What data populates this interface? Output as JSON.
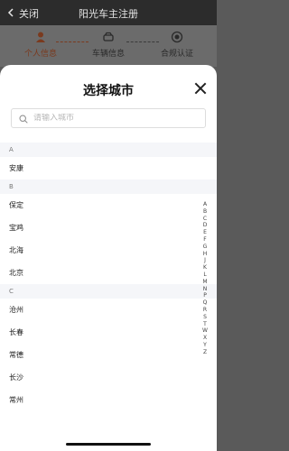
{
  "header": {
    "back_label": "关闭",
    "title": "阳光车主注册"
  },
  "steps": [
    {
      "label": "个人信息"
    },
    {
      "label": "车辆信息"
    },
    {
      "label": "合规认证"
    }
  ],
  "sheet": {
    "title": "选择城市",
    "search_placeholder": "请输入城市"
  },
  "groups": [
    {
      "letter": "A",
      "cities": [
        "安康"
      ]
    },
    {
      "letter": "B",
      "cities": [
        "保定",
        "宝鸡",
        "北海",
        "北京"
      ]
    },
    {
      "letter": "C",
      "cities": [
        "沧州",
        "长春",
        "常德",
        "长沙",
        "常州"
      ]
    }
  ],
  "index_letters": [
    "A",
    "B",
    "C",
    "D",
    "E",
    "F",
    "G",
    "H",
    "J",
    "K",
    "L",
    "M",
    "N",
    "P",
    "Q",
    "R",
    "S",
    "T",
    "W",
    "X",
    "Y",
    "Z"
  ],
  "colors": {
    "accent": "#c0552c"
  }
}
